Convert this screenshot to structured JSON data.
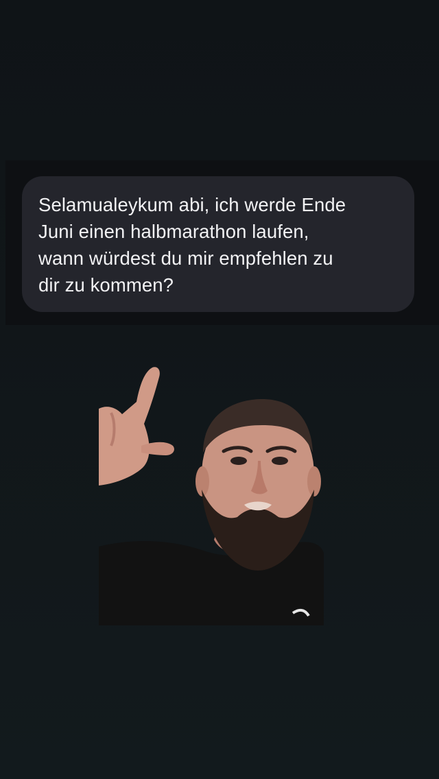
{
  "message": {
    "text": "Selamualeykum abi, ich werde Ende\nJuni einen halbmarathon laufen,\nwann würdest du mir empfehlen zu\ndir zu kommen?"
  },
  "video": {
    "subject": "bearded-man-pointing-up",
    "shirt_color": "#111111",
    "skin_color": "#c99482",
    "beard_color": "#2a1e19"
  }
}
